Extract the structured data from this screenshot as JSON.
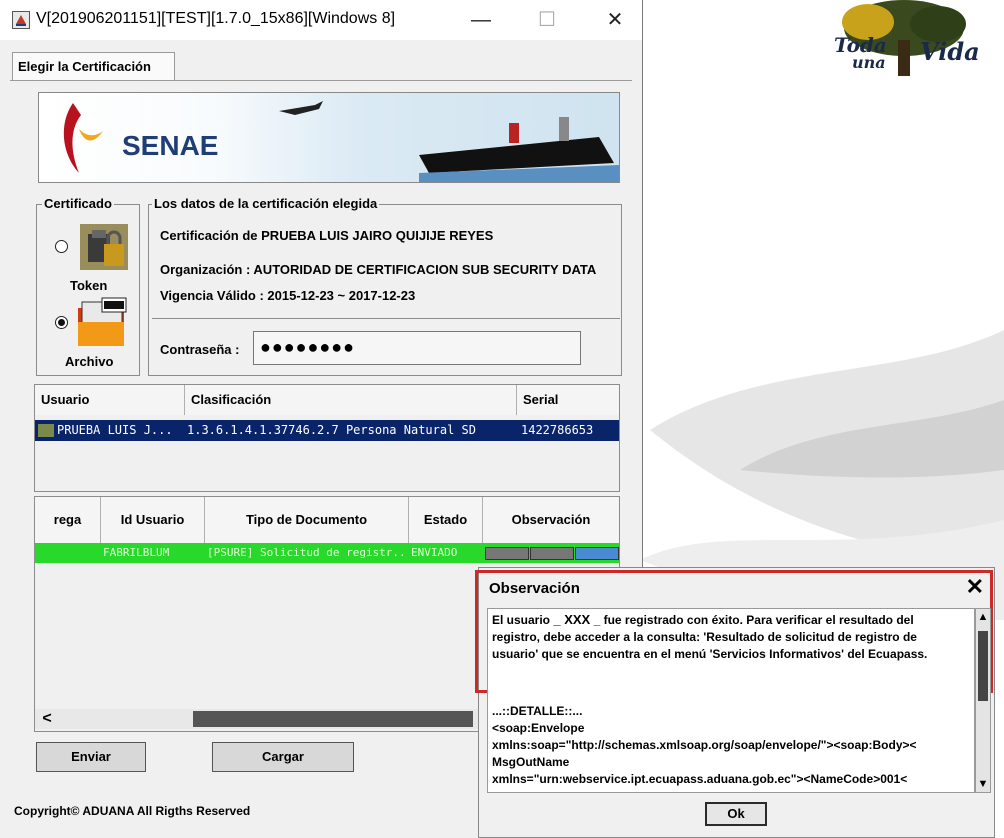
{
  "window": {
    "title": "V[201906201151][TEST][1.7.0_15x86][Windows 8]",
    "minimize_glyph": "—",
    "maximize_glyph": "☐",
    "close_glyph": "✕"
  },
  "tabs": [
    {
      "label": "Elegir la Certificación"
    }
  ],
  "banner": {
    "brand": "SENAE"
  },
  "certificado": {
    "legend": "Certificado",
    "options": [
      {
        "label": "Token",
        "selected": false,
        "icon": "token-icon"
      },
      {
        "label": "Archivo",
        "selected": true,
        "icon": "file-icon"
      }
    ]
  },
  "cert_data": {
    "legend": "Los datos de la certificación elegida",
    "name": "Certificación de PRUEBA LUIS JAIRO QUIJIJE REYES",
    "organization": "Organización : AUTORIDAD DE CERTIFICACION SUB SECURITY DATA",
    "validity": "Vigencia Válido : 2015-12-23 ~ 2017-12-23",
    "password_label": "Contraseña :",
    "password_value": "●●●●●●●●"
  },
  "cert_table": {
    "headers": [
      "Usuario",
      "Clasificación",
      "Serial"
    ],
    "rows": [
      {
        "usuario": "PRUEBA LUIS J...",
        "clasificacion": "1.3.6.1.4.1.37746.2.7 Persona Natural SD",
        "serial": "1422786653"
      }
    ]
  },
  "request_table": {
    "headers": [
      "rega",
      "Id Usuario",
      "Tipo de Documento",
      "Estado",
      "Observación"
    ],
    "rows": [
      {
        "id_usuario": "FABRILBLUM",
        "tipo": "[PSURE] Solicitud de registr...",
        "estado": "ENVIADO"
      }
    ],
    "scroll_left": "<"
  },
  "buttons": {
    "enviar": "Enviar",
    "cargar": "Cargar"
  },
  "footer": "Copyright© ADUANA All Rigths Reserved",
  "dialog": {
    "title": "Observación",
    "close": "✕",
    "msg_prefix": "El usuario",
    "msg_user": "_ XXX",
    "msg_rest": "_ fue registrado con éxito. Para verificar el resultado del registro, debe acceder a la consulta: 'Resultado de solicitud de registro de usuario' que se encuentra en el menú 'Servicios Informativos' del Ecuapass.",
    "detail_lines": [
      "...::DETALLE::...",
      "<soap:Envelope",
      "xmlns:soap=\"http://schemas.xmlsoap.org/soap/envelope/\"><soap:Body><",
      "MsgOutName",
      "xmlns=\"urn:webservice.ipt.ecuapass.aduana.gob.ec\"><NameCode>001<"
    ],
    "ok": "Ok"
  },
  "background": {
    "logo_line1": "Toda",
    "logo_line2": "una",
    "logo_line3": "Vida"
  },
  "colors": {
    "selection": "#0a246a",
    "status_green": "#28d82b",
    "brand_blue": "#1f3d77",
    "highlight_red": "#cc2a2a"
  }
}
